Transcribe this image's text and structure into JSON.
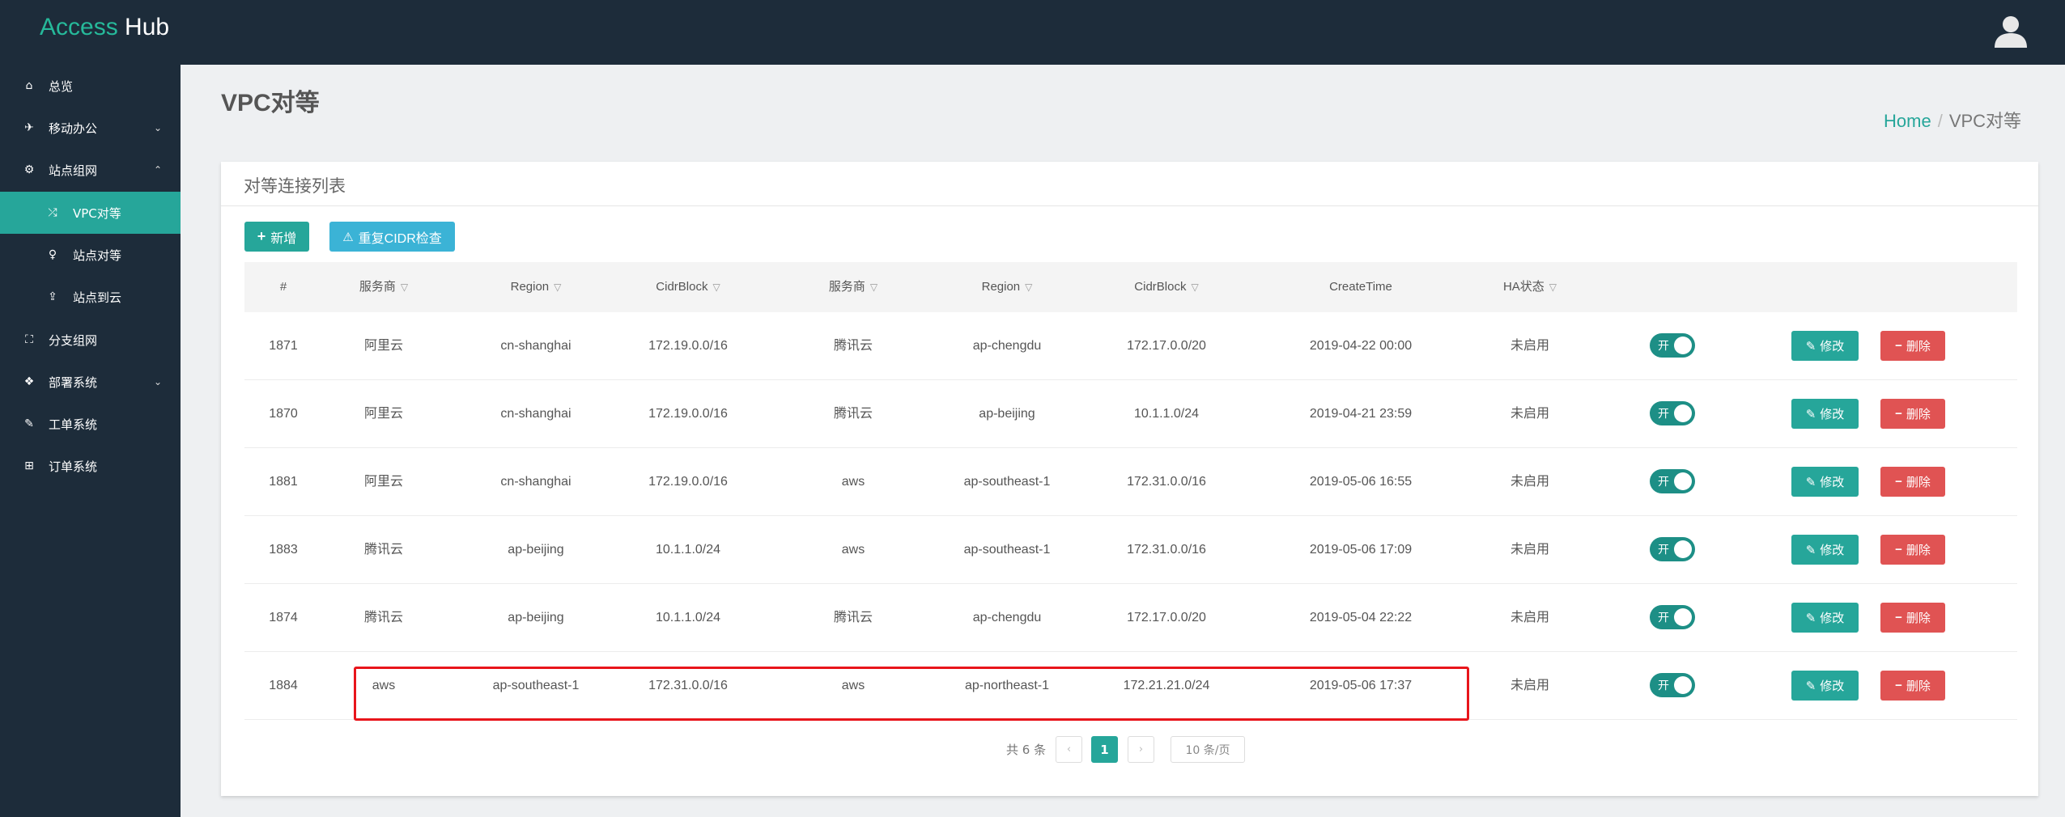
{
  "header": {
    "brand_part1": "Access",
    "brand_part2": "Hub",
    "user_icon": "user-icon"
  },
  "sidebar": {
    "items": [
      {
        "label": "总览",
        "icon": "home-icon",
        "glyph": "⌂"
      },
      {
        "label": "移动办公",
        "icon": "plane-icon",
        "glyph": "✈",
        "chevron": "⌄"
      },
      {
        "label": "站点组网",
        "icon": "network-icon",
        "glyph": "⚙",
        "chevron": "⌃"
      },
      {
        "label": "VPC对等",
        "icon": "shuffle-icon",
        "glyph": "⤮",
        "active": true,
        "sub": true
      },
      {
        "label": "站点对等",
        "icon": "venus-icon",
        "glyph": "♀",
        "sub": true
      },
      {
        "label": "站点到云",
        "icon": "upload-icon",
        "glyph": "⇪",
        "sub": true
      },
      {
        "label": "分支组网",
        "icon": "sitemap-icon",
        "glyph": "⛶"
      },
      {
        "label": "部署系统",
        "icon": "cubes-icon",
        "glyph": "❖",
        "chevron": "⌄"
      },
      {
        "label": "工单系统",
        "icon": "wrench-icon",
        "glyph": "✎"
      },
      {
        "label": "订单系统",
        "icon": "cart-icon",
        "glyph": "⊞"
      }
    ]
  },
  "page": {
    "title": "VPC对等",
    "breadcrumb_home": "Home",
    "breadcrumb_sep": "/",
    "breadcrumb_current": "VPC对等"
  },
  "panel": {
    "title": "对等连接列表",
    "add_label": "新增",
    "cidr_label": "重复CIDR检查"
  },
  "table": {
    "columns": [
      "#",
      "服务商",
      "Region",
      "CidrBlock",
      "服务商",
      "Region",
      "CidrBlock",
      "CreateTime",
      "HA状态"
    ],
    "rows": [
      [
        "1871",
        "阿里云",
        "cn-shanghai",
        "172.19.0.0/16",
        "腾讯云",
        "ap-chengdu",
        "172.17.0.0/20",
        "2019-04-22 00:00",
        "未启用"
      ],
      [
        "1870",
        "阿里云",
        "cn-shanghai",
        "172.19.0.0/16",
        "腾讯云",
        "ap-beijing",
        "10.1.1.0/24",
        "2019-04-21 23:59",
        "未启用"
      ],
      [
        "1881",
        "阿里云",
        "cn-shanghai",
        "172.19.0.0/16",
        "aws",
        "ap-southeast-1",
        "172.31.0.0/16",
        "2019-05-06 16:55",
        "未启用"
      ],
      [
        "1883",
        "腾讯云",
        "ap-beijing",
        "10.1.1.0/24",
        "aws",
        "ap-southeast-1",
        "172.31.0.0/16",
        "2019-05-06 17:09",
        "未启用"
      ],
      [
        "1874",
        "腾讯云",
        "ap-beijing",
        "10.1.1.0/24",
        "腾讯云",
        "ap-chengdu",
        "172.17.0.0/20",
        "2019-05-04 22:22",
        "未启用"
      ],
      [
        "1884",
        "aws",
        "ap-southeast-1",
        "172.31.0.0/16",
        "aws",
        "ap-northeast-1",
        "172.21.21.0/24",
        "2019-05-06 17:37",
        "未启用"
      ]
    ],
    "toggle_label": "开",
    "edit_label": "修改",
    "delete_label": "删除"
  },
  "pagination": {
    "total_text": "共 6 条",
    "prev": "‹",
    "current_page": "1",
    "next": "›",
    "page_size": "10 条/页"
  },
  "colors": {
    "accent": "#26a69a",
    "header_bg": "#1d2c3a",
    "danger": "#e05353",
    "info": "#3bb3d6",
    "highlight_box": "#e8151b"
  }
}
